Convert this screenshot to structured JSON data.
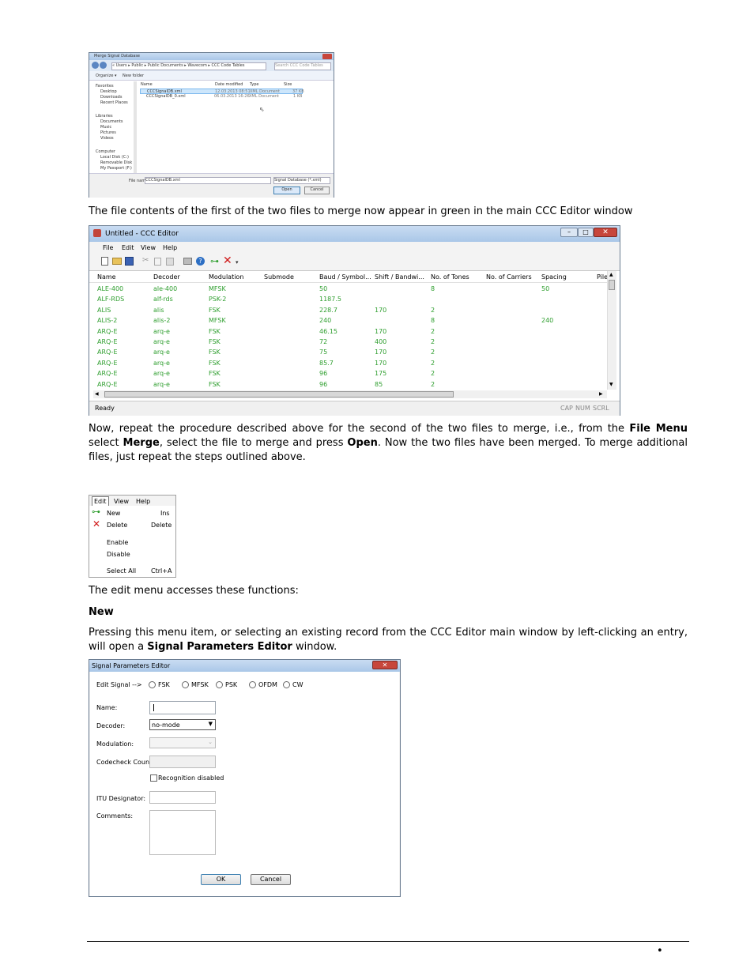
{
  "merge_dialog": {
    "title": "Merge Signal Database",
    "address": "« Users ▸ Public ▸ Public Documents ▸ Wavecom ▸ CCC Code Tables",
    "search_placeholder": "Search CCC Code Tables",
    "organize": "Organize ▾",
    "new_folder": "New folder",
    "nav": {
      "favorites": [
        "Favorites",
        "Desktop",
        "Downloads",
        "Recent Places"
      ],
      "libraries": [
        "Libraries",
        "Documents",
        "Music",
        "Pictures",
        "Videos"
      ],
      "computer": [
        "Computer",
        "Local Disk (C:)",
        "Removable Disk (",
        "My Passport (F:)"
      ]
    },
    "columns": [
      "Name",
      "Date modified",
      "Type",
      "Size"
    ],
    "files": [
      {
        "name": "CCCSignalDB.xml",
        "date": "12.03.2013 08:51",
        "type": "XML Document",
        "size": "37 KB"
      },
      {
        "name": "CCCSignalDB_0.xml",
        "date": "06.03.2013 16:26",
        "type": "XML Document",
        "size": "1 KB"
      }
    ],
    "file_name_label": "File name:",
    "file_name_value": "CCCSignalDB.xml",
    "filter": "Signal Database (*.xml)",
    "open": "Open",
    "cancel": "Cancel"
  },
  "text": {
    "p1": "The file contents of the first of the two files to merge now appear in green in the main CCC Editor window",
    "p2_a": "Now, repeat the procedure described above for the second of the two files to merge, i.e., from the ",
    "p2_file": "File Menu",
    "p2_b": " select ",
    "p2_merge": "Merge",
    "p2_c": ", select the file to merge and press ",
    "p2_open": "Open",
    "p2_d": ". Now the two files have been merged. To merge additional files, just repeat the steps outlined above.",
    "p3": "The edit menu accesses these functions:",
    "h_new": "New",
    "p4_a": "Pressing this menu item, or selecting an existing record from the CCC Editor main window by left-clicking an entry, will open a ",
    "p4_bold": "Signal Parameters Editor",
    "p4_b": " window.",
    "footer_bullet": "•"
  },
  "ccc_editor": {
    "title": "Untitled - CCC Editor",
    "menu": [
      "File",
      "Edit",
      "View",
      "Help"
    ],
    "columns": [
      "Name",
      "Decoder",
      "Modulation",
      "Submode",
      "Baud / Symbol...",
      "Shift / Bandwi...",
      "No. of Tones",
      "No. of Carriers",
      "Spacing",
      "Pile"
    ],
    "rows": [
      [
        "ALE-400",
        "ale-400",
        "MFSK",
        "",
        "50",
        "",
        "8",
        "",
        "50"
      ],
      [
        "ALF-RDS",
        "alf-rds",
        "PSK-2",
        "",
        "1187.5",
        "",
        "",
        "",
        ""
      ],
      [
        "ALIS",
        "alis",
        "FSK",
        "",
        "228.7",
        "170",
        "2",
        "",
        ""
      ],
      [
        "ALIS-2",
        "alis-2",
        "MFSK",
        "",
        "240",
        "",
        "8",
        "",
        "240"
      ],
      [
        "ARQ-E",
        "arq-e",
        "FSK",
        "",
        "46.15",
        "170",
        "2",
        "",
        ""
      ],
      [
        "ARQ-E",
        "arq-e",
        "FSK",
        "",
        "72",
        "400",
        "2",
        "",
        ""
      ],
      [
        "ARQ-E",
        "arq-e",
        "FSK",
        "",
        "75",
        "170",
        "2",
        "",
        ""
      ],
      [
        "ARQ-E",
        "arq-e",
        "FSK",
        "",
        "85.7",
        "170",
        "2",
        "",
        ""
      ],
      [
        "ARQ-E",
        "arq-e",
        "FSK",
        "",
        "96",
        "175",
        "2",
        "",
        ""
      ],
      [
        "ARQ-E",
        "arq-e",
        "FSK",
        "",
        "96",
        "85",
        "2",
        "",
        ""
      ]
    ],
    "status": "Ready",
    "indicators": [
      "CAP",
      "NUM",
      "SCRL"
    ]
  },
  "edit_menu": {
    "bar": [
      "Edit",
      "View",
      "Help"
    ],
    "items": [
      {
        "label": "New",
        "shortcut": "Ins"
      },
      {
        "label": "Delete",
        "shortcut": "Delete"
      },
      {
        "label": "Enable",
        "shortcut": ""
      },
      {
        "label": "Disable",
        "shortcut": ""
      },
      {
        "label": "Select All",
        "shortcut": "Ctrl+A"
      }
    ]
  },
  "spe": {
    "title": "Signal Parameters Editor",
    "edit_signal": "Edit Signal -->",
    "modes": [
      "FSK",
      "MFSK",
      "PSK",
      "OFDM",
      "CW"
    ],
    "name_label": "Name:",
    "decoder_label": "Decoder:",
    "decoder_value": "no-mode",
    "modulation_label": "Modulation:",
    "codecheck_label": "Codecheck Count:",
    "recognition_label": "Recognition disabled",
    "itu_label": "ITU Designator:",
    "comments_label": "Comments:",
    "ok": "OK",
    "cancel": "Cancel"
  }
}
